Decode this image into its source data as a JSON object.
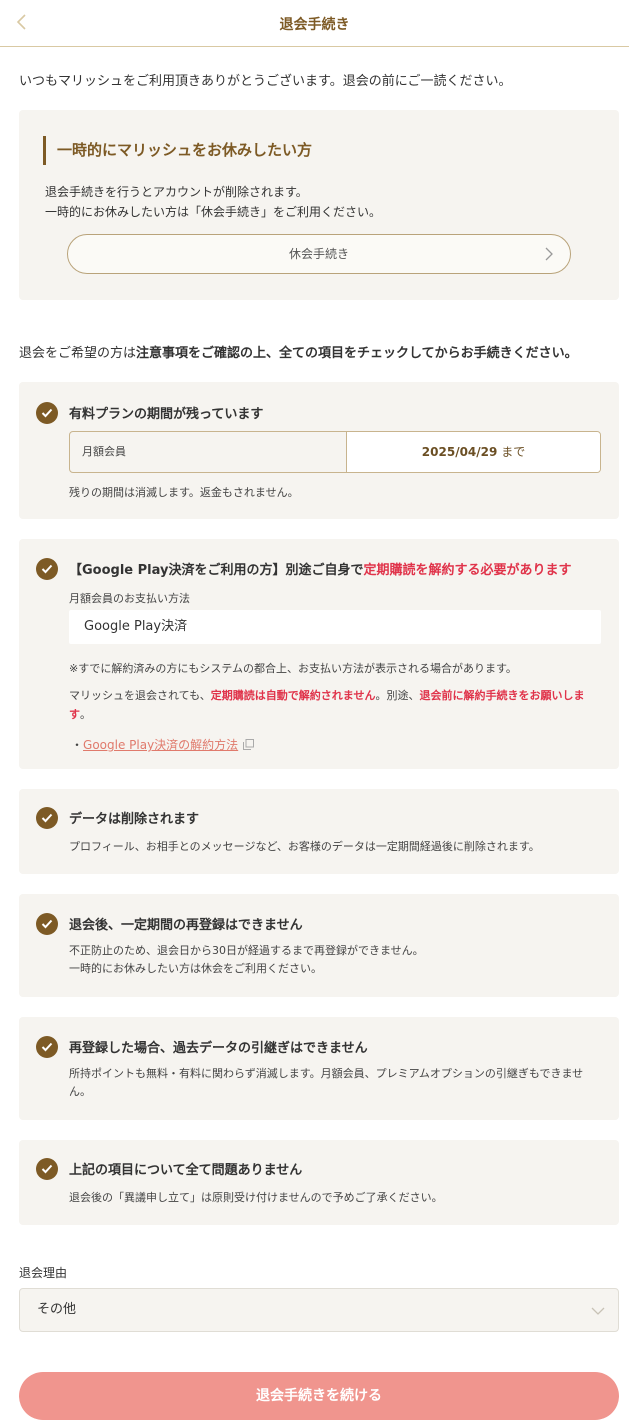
{
  "header": {
    "title": "退会手続き"
  },
  "intro": "いつもマリッシュをご利用頂きありがとうございます。退会の前にご一読ください。",
  "pause_section": {
    "heading": "一時的にマリッシュをお休みしたい方",
    "desc_line1": "退会手続きを行うとアカウントが削除されます。",
    "desc_line2": "一時的にお休みしたい方は「休会手続き」をご利用ください。",
    "button_label": "休会手続き"
  },
  "notice": {
    "text_prefix": "退会をご希望の方は",
    "text_bold": "注意事項をご確認の上、全ての項目をチェックしてからお手続きください。"
  },
  "items": [
    {
      "title": "有料プランの期間が残っています",
      "plan_name": "月額会員",
      "plan_end_date": "2025/04/29",
      "plan_end_suffix": "まで",
      "desc": "残りの期間は消滅します。返金もされません。"
    },
    {
      "title_prefix": "【Google Play決済をご利用の方】別途ご自身で",
      "title_red": "定期購読を解約する必要があります",
      "payment_label": "月額会員のお支払い方法",
      "payment_method": "Google Play決済",
      "note1": "※すでに解約済みの方にもシステムの都合上、お支払い方法が表示される場合があります。",
      "note2_a": "マリッシュを退会されても、",
      "note2_red1": "定期購読は自動で解約されません",
      "note2_b": "。別途、",
      "note2_red2": "退会前に解約手続きをお願いします",
      "note2_c": "。",
      "link_bullet": "・",
      "link_label": "Google Play決済の解約方法"
    },
    {
      "title": "データは削除されます",
      "desc": "プロフィール、お相手とのメッセージなど、お客様のデータは一定期間経過後に削除されます。"
    },
    {
      "title": "退会後、一定期間の再登録はできません",
      "desc_line1": "不正防止のため、退会日から30日が経過するまで再登録ができません。",
      "desc_line2": "一時的にお休みしたい方は休会をご利用ください。"
    },
    {
      "title": "再登録した場合、過去データの引継ぎはできません",
      "desc": "所持ポイントも無料・有料に関わらず消滅します。月額会員、プレミアムオプションの引継ぎもできません。"
    },
    {
      "title": "上記の項目について全て問題ありません",
      "desc": "退会後の「異議申し立て」は原則受け付けませんので予めご了承ください。"
    }
  ],
  "reason": {
    "label": "退会理由",
    "selected": "その他"
  },
  "submit_label": "退会手続きを続ける",
  "colors": {
    "brand_brown": "#7d5a25",
    "card_bg": "#f6f4f0",
    "alert_red": "#e0334a",
    "link": "#e07a6c",
    "submit_bg": "#f0958e"
  },
  "icons": {
    "back": "chevron-left-icon",
    "check": "check-circle-icon",
    "external": "external-link-icon",
    "dropdown": "chevron-down-icon"
  }
}
